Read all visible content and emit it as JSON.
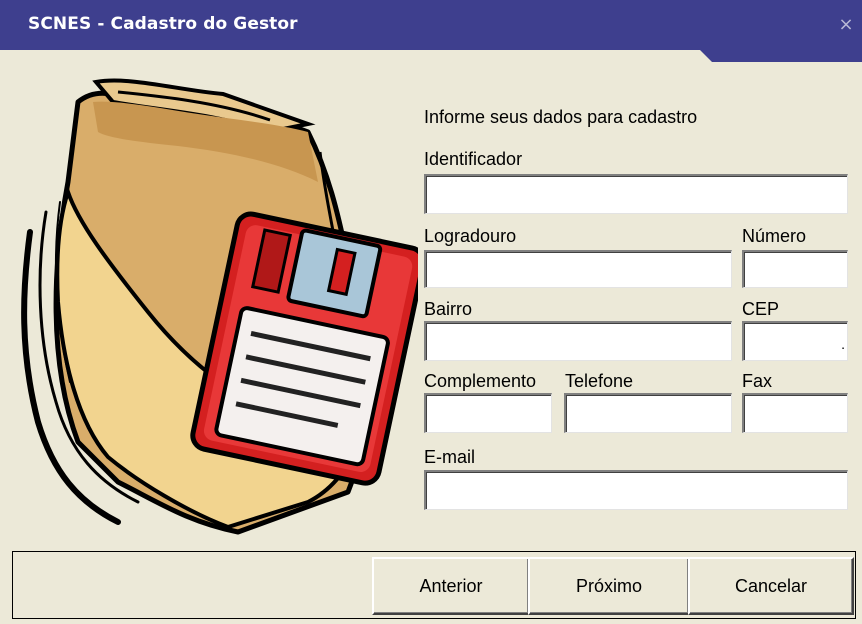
{
  "window": {
    "title": "SCNES - Cadastro do Gestor",
    "close_glyph": "×"
  },
  "form": {
    "heading": "Informe seus dados para cadastro",
    "fields": {
      "identificador": {
        "label": "Identificador",
        "value": ""
      },
      "logradouro": {
        "label": "Logradouro",
        "value": ""
      },
      "numero": {
        "label": "Número",
        "value": ""
      },
      "bairro": {
        "label": "Bairro",
        "value": ""
      },
      "cep": {
        "label": "CEP",
        "value": "",
        "mask_char": "."
      },
      "complemento": {
        "label": "Complemento",
        "value": ""
      },
      "telefone": {
        "label": "Telefone",
        "value": ""
      },
      "fax": {
        "label": "Fax",
        "value": ""
      },
      "email": {
        "label": "E-mail",
        "value": ""
      }
    }
  },
  "buttons": {
    "anterior": "Anterior",
    "proximo": "Próximo",
    "cancelar": "Cancelar"
  },
  "illustration": {
    "icon": "folder-with-floppy-disk"
  },
  "colors": {
    "titlebar": "#3e3f8e",
    "window_bg": "#ece9d8",
    "folder": "#d9ad6a",
    "floppy": "#d42020"
  }
}
